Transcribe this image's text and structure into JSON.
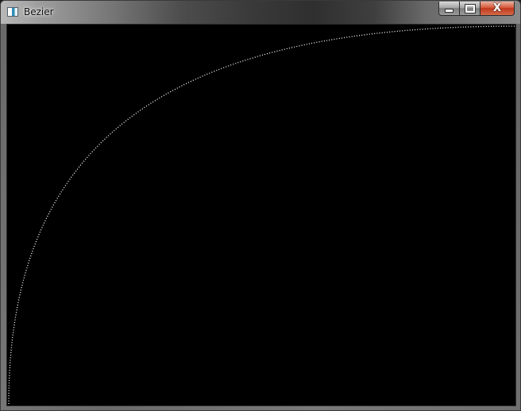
{
  "window": {
    "title": "Bezier",
    "icon": "application-window-icon"
  },
  "controls": {
    "minimize_icon": "minimize-icon",
    "maximize_icon": "maximize-icon",
    "close_icon": "close-icon",
    "close_glyph": "X"
  },
  "canvas": {
    "background": "#000000",
    "curve_color": "#ffffff",
    "curve_style": "dotted",
    "curve_type": "bezier"
  }
}
